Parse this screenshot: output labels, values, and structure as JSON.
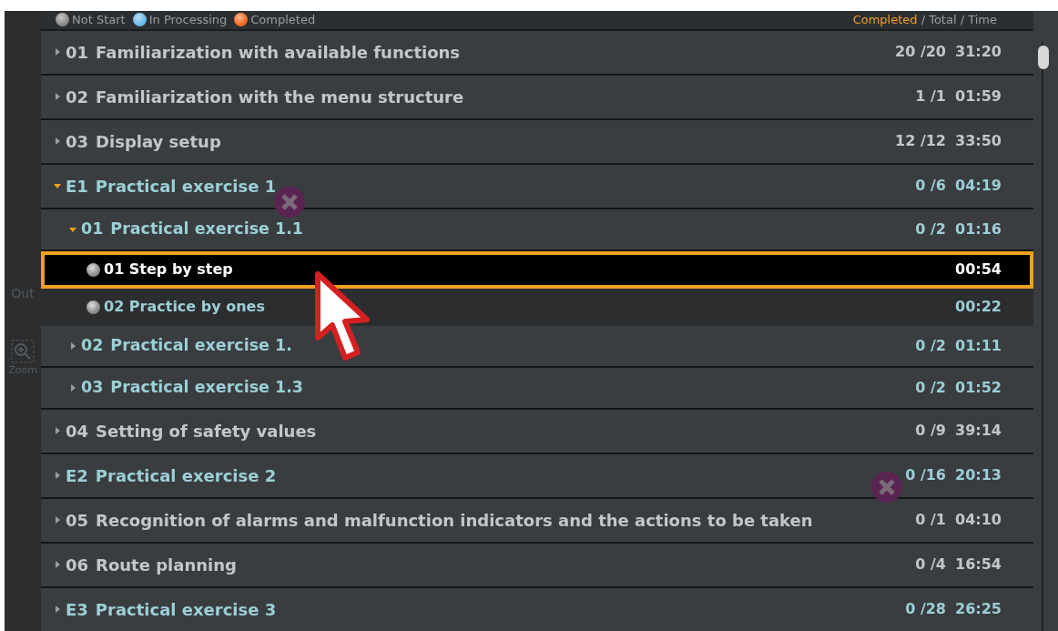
{
  "side_tools": [
    {
      "kind": "text",
      "label": "Out"
    },
    {
      "kind": "zoom",
      "label": "Zoom"
    }
  ],
  "legend": [
    {
      "label": "Not Start",
      "color": "#8a8a8a"
    },
    {
      "label": "In Processing",
      "color": "#6ab8e8"
    },
    {
      "label": "Completed",
      "color": "#f06a20"
    }
  ],
  "column_header": {
    "highlight": "Completed",
    "rest": " / Total / Time"
  },
  "rows": [
    {
      "kind": "topic",
      "number": "01",
      "title": "Familiarization with available functions",
      "count": "20 /20",
      "time": "31:20",
      "expanded": false
    },
    {
      "kind": "topic",
      "number": "02",
      "title": "Familiarization with the menu structure",
      "count": "1 /1",
      "time": "01:59",
      "expanded": false
    },
    {
      "kind": "topic",
      "number": "03",
      "title": "Display setup",
      "count": "12 /12",
      "time": "33:50",
      "expanded": false
    },
    {
      "kind": "exercise",
      "number": "E1",
      "title": "Practical exercise 1",
      "count": "0 /6",
      "time": "04:19",
      "expanded": true,
      "children": [
        {
          "kind": "exercise",
          "number": "01",
          "title": "Practical exercise 1.1",
          "count": "0 /2",
          "time": "01:16",
          "expanded": true,
          "children": [
            {
              "kind": "step",
              "title": "01 Step by step",
              "time": "00:54",
              "color": "#8a8a8a",
              "selected": true
            },
            {
              "kind": "step",
              "title": "02 Practice by ones",
              "time": "00:22",
              "color": "#8a8a8a",
              "selected": false
            }
          ]
        },
        {
          "kind": "exercise",
          "number": "02",
          "title": "Practical exercise 1.",
          "count": "0 /2",
          "time": "01:11",
          "expanded": false
        },
        {
          "kind": "exercise",
          "number": "03",
          "title": "Practical exercise 1.3",
          "count": "0 /2",
          "time": "01:52",
          "expanded": false
        }
      ]
    },
    {
      "kind": "topic",
      "number": "04",
      "title": "Setting of safety values",
      "count": "0 /9",
      "time": "39:14",
      "expanded": false
    },
    {
      "kind": "exercise",
      "number": "E2",
      "title": "Practical exercise 2",
      "count": "0 /16",
      "time": "20:13",
      "expanded": false
    },
    {
      "kind": "topic",
      "number": "05",
      "title": "Recognition of alarms and malfunction indicators and the actions to be taken",
      "count": "0 /1",
      "time": "04:10",
      "expanded": false
    },
    {
      "kind": "topic",
      "number": "06",
      "title": "Route planning",
      "count": "0 /4",
      "time": "16:54",
      "expanded": false
    },
    {
      "kind": "exercise",
      "number": "E3",
      "title": "Practical exercise 3",
      "count": "0 /28",
      "time": "26:25",
      "expanded": false
    }
  ]
}
